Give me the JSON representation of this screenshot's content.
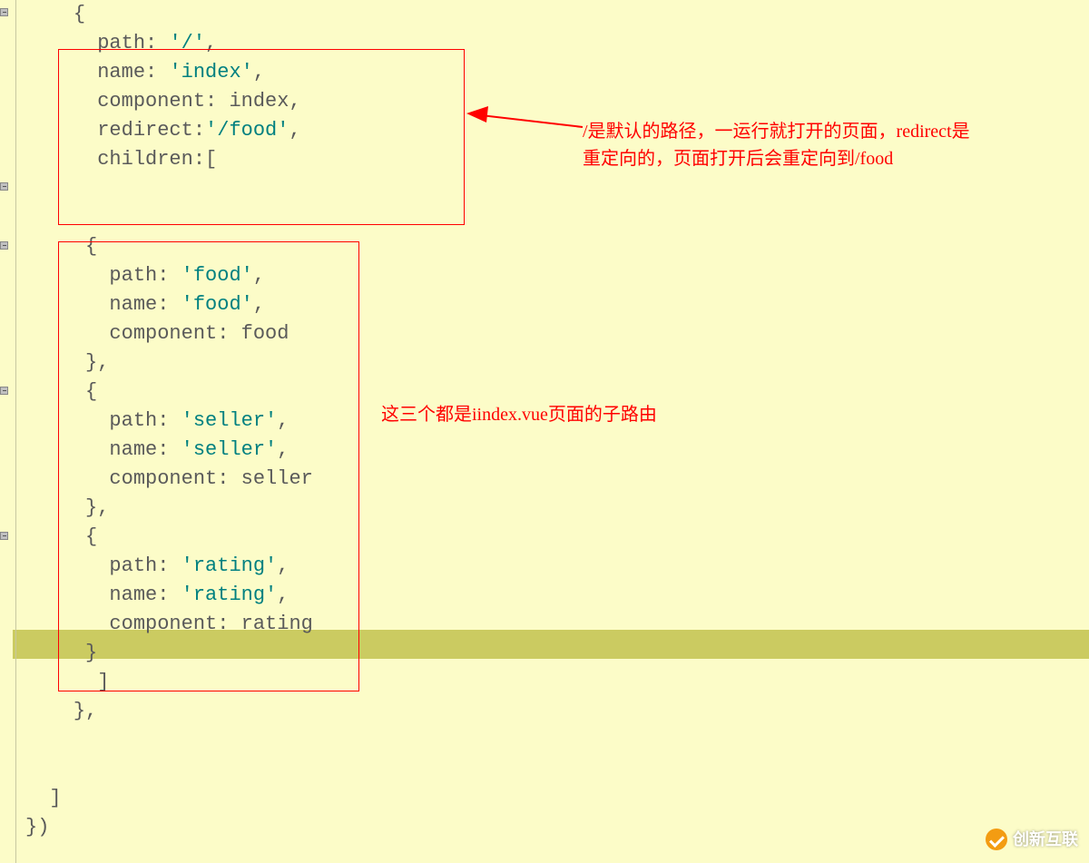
{
  "code": {
    "lines": [
      {
        "indent": "    ",
        "parts": [
          {
            "t": "{",
            "c": "plain"
          }
        ]
      },
      {
        "indent": "      ",
        "parts": [
          {
            "t": "path: ",
            "c": "plain"
          },
          {
            "t": "'/'",
            "c": "str"
          },
          {
            "t": ",",
            "c": "plain"
          }
        ]
      },
      {
        "indent": "      ",
        "parts": [
          {
            "t": "name: ",
            "c": "plain"
          },
          {
            "t": "'index'",
            "c": "str"
          },
          {
            "t": ",",
            "c": "plain"
          }
        ]
      },
      {
        "indent": "      ",
        "parts": [
          {
            "t": "component: index,",
            "c": "plain"
          }
        ]
      },
      {
        "indent": "      ",
        "parts": [
          {
            "t": "redirect:",
            "c": "plain"
          },
          {
            "t": "'/food'",
            "c": "str"
          },
          {
            "t": ",",
            "c": "plain"
          }
        ]
      },
      {
        "indent": "      ",
        "parts": [
          {
            "t": "children:[",
            "c": "plain"
          }
        ]
      },
      {
        "indent": "",
        "parts": []
      },
      {
        "indent": "",
        "parts": []
      },
      {
        "indent": "     ",
        "parts": [
          {
            "t": "{",
            "c": "plain"
          }
        ]
      },
      {
        "indent": "       ",
        "parts": [
          {
            "t": "path: ",
            "c": "plain"
          },
          {
            "t": "'food'",
            "c": "str"
          },
          {
            "t": ",",
            "c": "plain"
          }
        ]
      },
      {
        "indent": "       ",
        "parts": [
          {
            "t": "name: ",
            "c": "plain"
          },
          {
            "t": "'food'",
            "c": "str"
          },
          {
            "t": ",",
            "c": "plain"
          }
        ]
      },
      {
        "indent": "       ",
        "parts": [
          {
            "t": "component: food",
            "c": "plain"
          }
        ]
      },
      {
        "indent": "     ",
        "parts": [
          {
            "t": "},",
            "c": "plain"
          }
        ]
      },
      {
        "indent": "     ",
        "parts": [
          {
            "t": "{",
            "c": "plain"
          }
        ]
      },
      {
        "indent": "       ",
        "parts": [
          {
            "t": "path: ",
            "c": "plain"
          },
          {
            "t": "'seller'",
            "c": "str"
          },
          {
            "t": ",",
            "c": "plain"
          }
        ]
      },
      {
        "indent": "       ",
        "parts": [
          {
            "t": "name: ",
            "c": "plain"
          },
          {
            "t": "'seller'",
            "c": "str"
          },
          {
            "t": ",",
            "c": "plain"
          }
        ]
      },
      {
        "indent": "       ",
        "parts": [
          {
            "t": "component: seller",
            "c": "plain"
          }
        ]
      },
      {
        "indent": "     ",
        "parts": [
          {
            "t": "},",
            "c": "plain"
          }
        ]
      },
      {
        "indent": "     ",
        "parts": [
          {
            "t": "{",
            "c": "plain"
          }
        ]
      },
      {
        "indent": "       ",
        "parts": [
          {
            "t": "path: ",
            "c": "plain"
          },
          {
            "t": "'rating'",
            "c": "str"
          },
          {
            "t": ",",
            "c": "plain"
          }
        ]
      },
      {
        "indent": "       ",
        "parts": [
          {
            "t": "name: ",
            "c": "plain"
          },
          {
            "t": "'rating'",
            "c": "str"
          },
          {
            "t": ",",
            "c": "plain"
          }
        ]
      },
      {
        "indent": "       ",
        "parts": [
          {
            "t": "component: rating",
            "c": "plain"
          }
        ]
      },
      {
        "indent": "     ",
        "parts": [
          {
            "t": "}",
            "c": "plain"
          }
        ]
      },
      {
        "indent": "      ",
        "parts": [
          {
            "t": "]",
            "c": "plain"
          }
        ]
      },
      {
        "indent": "    ",
        "parts": [
          {
            "t": "},",
            "c": "plain"
          }
        ]
      },
      {
        "indent": "",
        "parts": []
      },
      {
        "indent": "",
        "parts": []
      },
      {
        "indent": "  ",
        "parts": [
          {
            "t": "]",
            "c": "plain"
          }
        ]
      },
      {
        "indent": "",
        "parts": [
          {
            "t": "})",
            "c": "plain"
          }
        ]
      }
    ]
  },
  "annotations": {
    "a1_line1": "/是默认的路径，一运行就打开的页面，redirect是",
    "a1_line2": "重定向的，页面打开后会重定向到/food",
    "a2": "这三个都是iindex.vue页面的子路由"
  },
  "watermark": "创新互联"
}
